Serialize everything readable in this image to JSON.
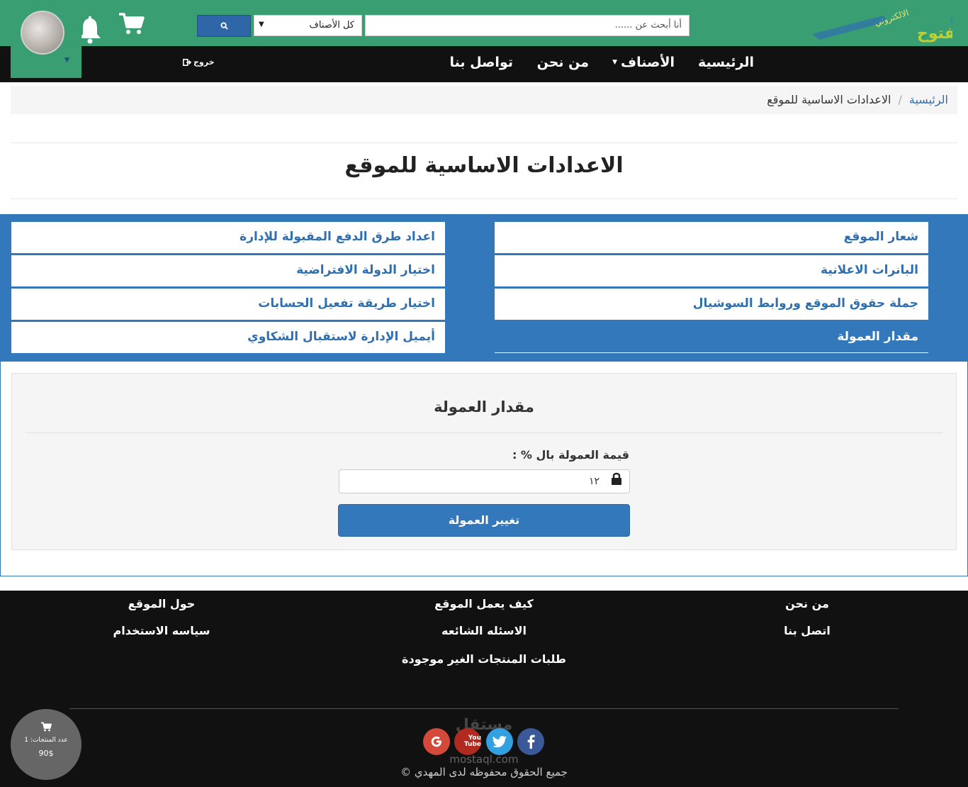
{
  "header": {
    "logo_text": "سوق المفتوح الالكتروني",
    "search_placeholder": "أنا أبحث عن ......",
    "category_select": "كل الأصناف",
    "colors": {
      "header_green": "#3a9e73",
      "primary_blue": "#3278ba",
      "dark": "#111111"
    }
  },
  "nav": {
    "home": "الرئيسية",
    "categories": "الأصناف",
    "about": "من نحن",
    "contact": "تواصل بنا",
    "logout": "خروج"
  },
  "breadcrumb": {
    "home": "الرئيسية",
    "separator": "/",
    "current": "الاعدادات الاساسية للموقع"
  },
  "page": {
    "title": "الاعدادات الاساسية للموقع"
  },
  "settings_menu": {
    "right": [
      {
        "label": "شعار الموقع"
      },
      {
        "label": "البانرات الاعلانية"
      },
      {
        "label": "جملة حقوق الموقع وروابط السوشيال"
      },
      {
        "label": "مقدار العمولة"
      }
    ],
    "left": [
      {
        "label": "اعداد طرق الدفع المقبولة للإدارة"
      },
      {
        "label": "اختيار الدولة الافتراضية"
      },
      {
        "label": "اختيار طريقة تفعيل الحسابات"
      },
      {
        "label": "أيميل الإدارة لاستقبال الشكاوي"
      }
    ],
    "active": "مقدار العمولة"
  },
  "form": {
    "title": "مقدار العمولة",
    "label": "قيمة العمولة بال % :",
    "value": "١٢",
    "submit": "تغيير العمولة"
  },
  "footer": {
    "links": {
      "about": "من نحن",
      "how_it_works": "كيف يعمل الموقع",
      "about_site": "حول الموقع",
      "contact": "اتصل بنا",
      "faq": "الاسئله الشائعه",
      "usage_policy": "سياسه الاستخدام",
      "missing_products": "طلبات المنتجات الغير موجودة"
    },
    "social": [
      "facebook-icon",
      "twitter-icon",
      "youtube-icon",
      "google-plus-icon"
    ],
    "youtube_label": "You Tube",
    "watermark": "مستقل",
    "watermark_url": "mostaql.com",
    "copyright": "جميع الحقوق محفوظه لدى المهدي ©"
  },
  "cart_widget": {
    "count_text": "عدد المنتجات: 1",
    "total": "90$"
  }
}
